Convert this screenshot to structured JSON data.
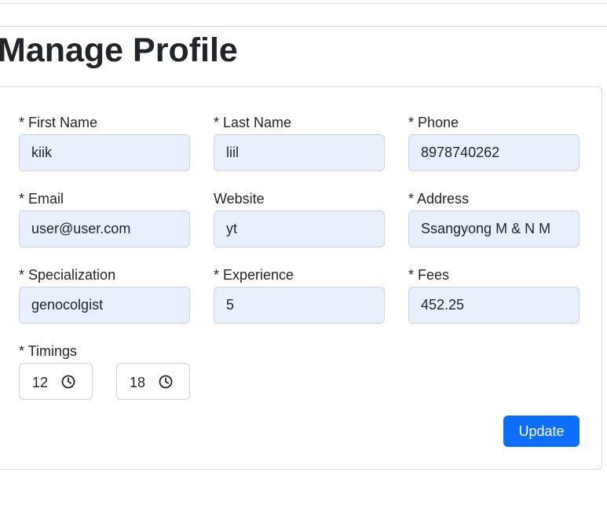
{
  "page": {
    "title": "Manage Profile"
  },
  "form": {
    "first_name": {
      "label": "* First Name",
      "value": "kiik"
    },
    "last_name": {
      "label": "* Last Name",
      "value": "liil"
    },
    "phone": {
      "label": "* Phone",
      "value": "8978740262"
    },
    "email": {
      "label": "* Email",
      "value": "user@user.com"
    },
    "website": {
      "label": "Website",
      "value": "yt"
    },
    "address": {
      "label": "* Address",
      "value": "Ssangyong M & N M"
    },
    "specialization": {
      "label": "* Specialization",
      "value": "genocolgist"
    },
    "experience": {
      "label": "* Experience",
      "value": "5"
    },
    "fees": {
      "label": "* Fees",
      "value": "452.25"
    },
    "timings": {
      "label": "* Timings",
      "start": "12",
      "end": "18",
      "icon": "clock-icon"
    },
    "update_label": "Update"
  },
  "colors": {
    "accent": "#0d6efd",
    "input_fill": "#e8f0fe",
    "border": "#ced4da"
  }
}
